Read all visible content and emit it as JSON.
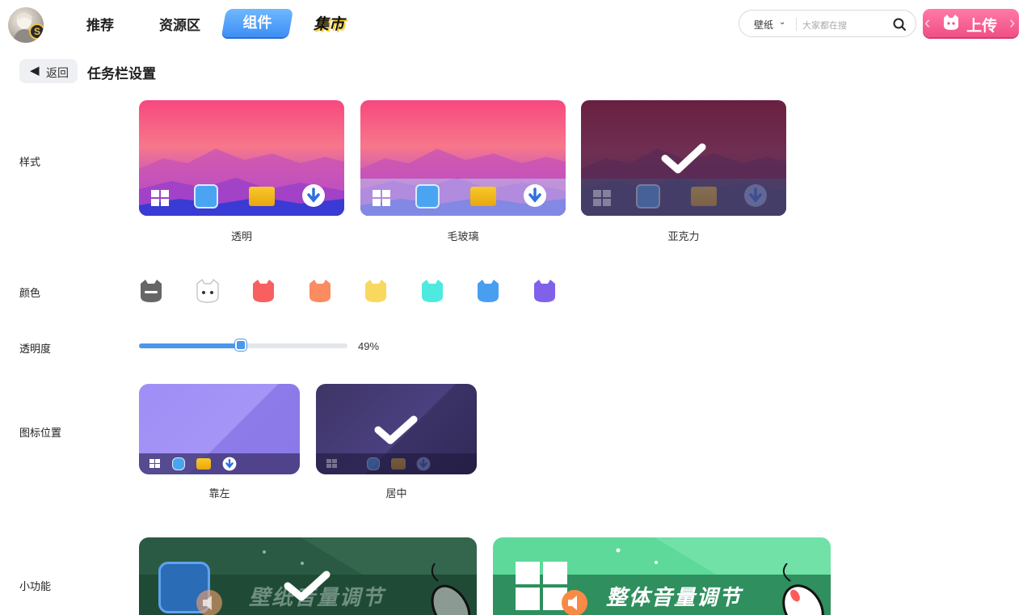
{
  "header": {
    "nav": [
      "推荐",
      "资源区",
      "组件",
      "集市"
    ],
    "active_nav": "组件",
    "search": {
      "category": "壁纸",
      "placeholder": "大家都在搜"
    },
    "upload_label": "上传",
    "avatar_badge": "S"
  },
  "page": {
    "back_label": "返回",
    "title": "任务栏设置"
  },
  "sections": {
    "style": {
      "label": "样式",
      "options": [
        "透明",
        "毛玻璃",
        "亚克力"
      ],
      "selected": "亚克力"
    },
    "color": {
      "label": "颜色",
      "swatches": [
        "#666666",
        "#ffffff",
        "#f7605f",
        "#fb8c62",
        "#f9d860",
        "#4eeadf",
        "#4a9ef0",
        "#8062ea"
      ]
    },
    "opacity": {
      "label": "透明度",
      "value": 0.49,
      "value_text": "49%"
    },
    "icon_position": {
      "label": "图标位置",
      "options": [
        "靠左",
        "居中"
      ],
      "selected": "居中"
    },
    "features": {
      "label": "小功能",
      "items": [
        "壁纸音量调节",
        "整体音量调节"
      ],
      "selected": "壁纸音量调节"
    }
  },
  "colors": {
    "accent": "#4b97ec",
    "upload_pink": "#f04f86"
  }
}
